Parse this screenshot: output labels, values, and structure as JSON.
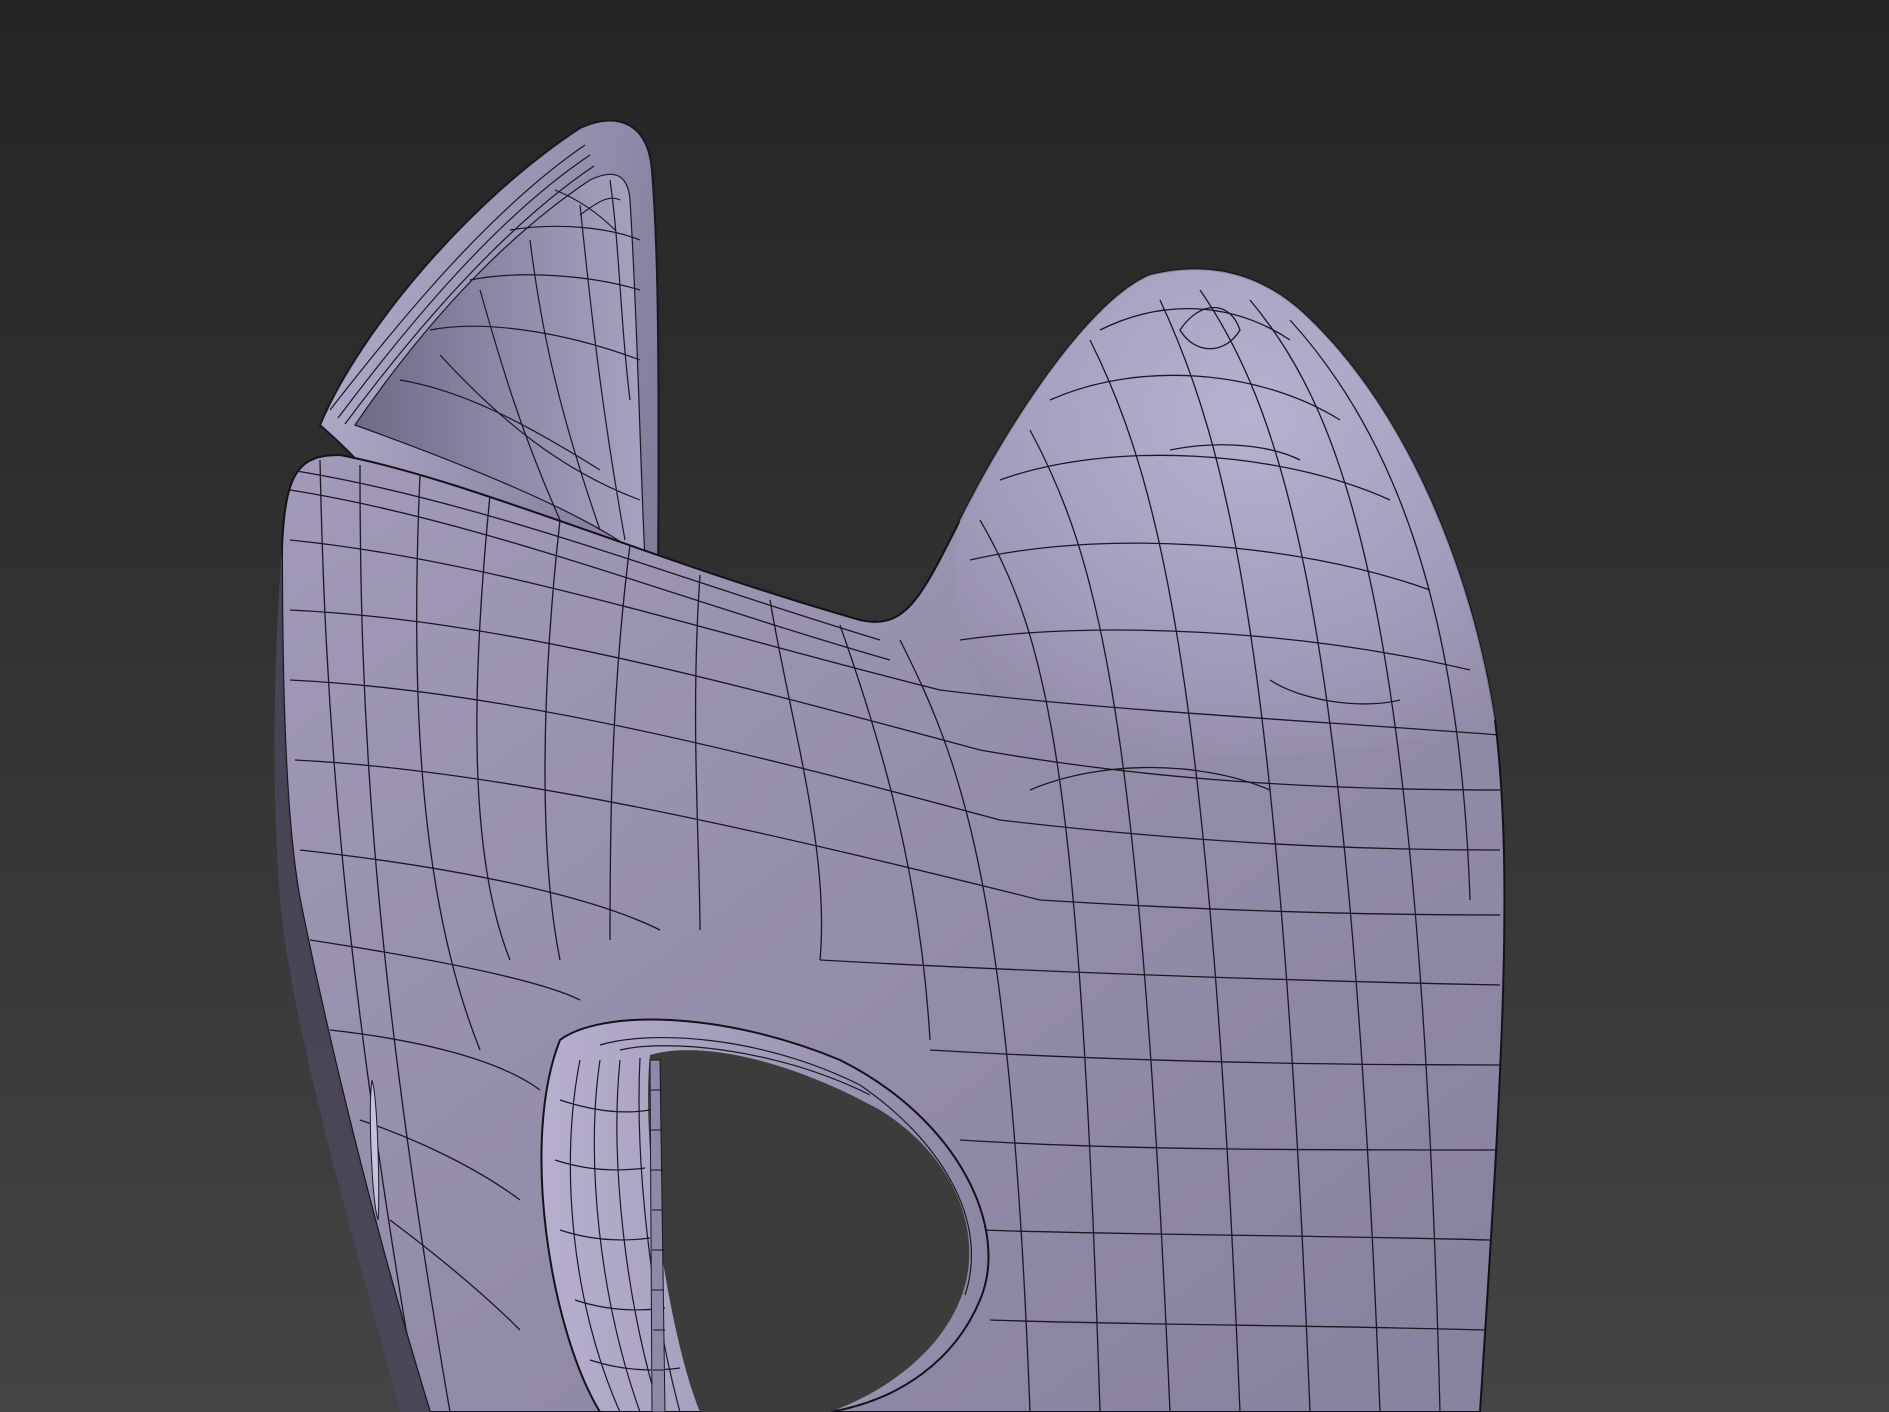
{
  "viewport": {
    "background_top": "#242424",
    "background_bottom": "#444444",
    "mesh_fill": "#a79fbe",
    "mesh_highlight": "#c4bedb",
    "mesh_shadow": "#6e6884",
    "wire_color": "#1a1722",
    "shading_mode": "smooth-shaded-with-wireframe",
    "object": "subdivided-chair-shell-mesh"
  }
}
